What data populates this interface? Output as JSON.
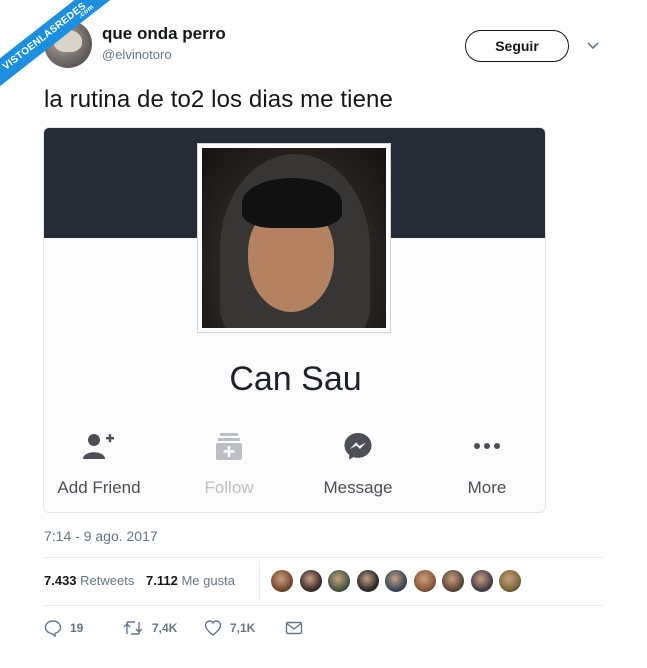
{
  "watermark": {
    "text": "VISTOENLASREDES",
    "suffix": ".com"
  },
  "author": {
    "name": "que onda perro",
    "handle": "@elvinotoro",
    "avatar_icon": "user-avatar-icon"
  },
  "follow_button": {
    "label": "Seguir"
  },
  "tweet": {
    "text": "la rutina de to2 los dias me tiene"
  },
  "embedded_profile": {
    "name": "Can Sau",
    "actions": [
      {
        "label": "Add Friend",
        "icon": "add-friend-icon",
        "enabled": true
      },
      {
        "label": "Follow",
        "icon": "follow-icon",
        "enabled": false
      },
      {
        "label": "Message",
        "icon": "messenger-icon",
        "enabled": true
      },
      {
        "label": "More",
        "icon": "more-dots-icon",
        "enabled": true
      }
    ]
  },
  "timestamp": "7:14 - 9 ago. 2017",
  "stats": {
    "retweets_count": "7.433",
    "retweets_label": "Retweets",
    "likes_count": "7.112",
    "likes_label": "Me gusta"
  },
  "likers_colors": [
    "#7a4a2e",
    "#3e2f2b",
    "#4a5a48",
    "#2c2c2c",
    "#3a4c5e",
    "#8b5a3c",
    "#5e4a3a",
    "#4b3f4a",
    "#7d6a3a"
  ],
  "actions": {
    "reply_count": "19",
    "retweet_count": "7,4K",
    "like_count": "7,1K"
  },
  "colors": {
    "accent": "#1da1f2",
    "secondary_text": "#657786",
    "cover": "#262b35"
  }
}
